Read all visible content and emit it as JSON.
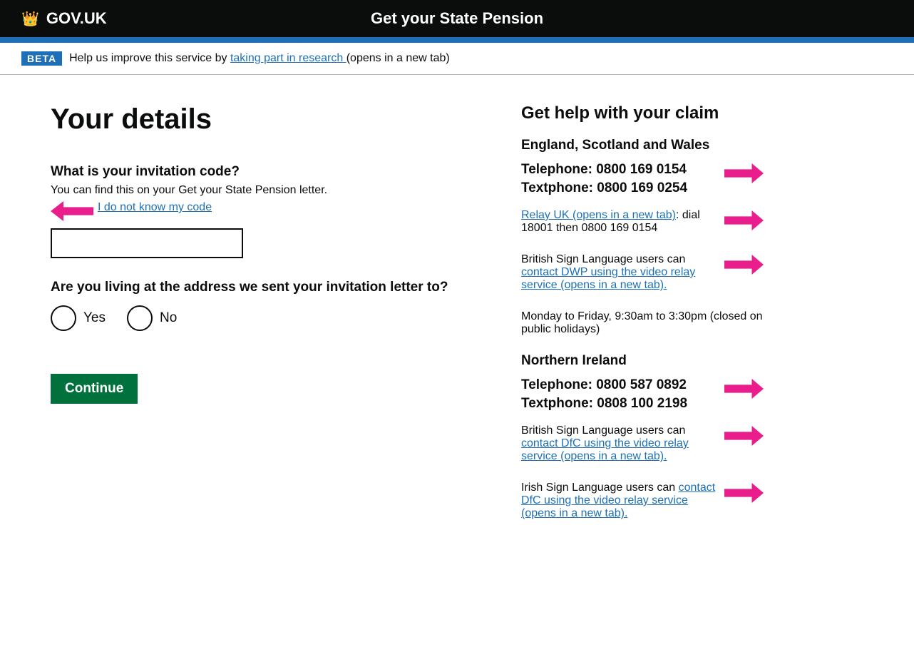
{
  "header": {
    "logo_text": "GOV.UK",
    "title": "Get your State Pension"
  },
  "beta": {
    "tag": "BETA",
    "text": "Help us improve this service by",
    "link_text": "taking part in research",
    "link_suffix": "(opens in a new tab)"
  },
  "main": {
    "page_title": "Your details",
    "invitation_code": {
      "label": "What is your invitation code?",
      "hint": "You can find this on your Get your State Pension letter.",
      "link_text": "I do not know my code",
      "input_value": "",
      "input_placeholder": ""
    },
    "address_question": {
      "label": "Are you living at the address we sent your invitation letter to?",
      "option_yes": "Yes",
      "option_no": "No"
    },
    "continue_button": "Continue"
  },
  "sidebar": {
    "title": "Get help with your claim",
    "england_section": {
      "region_title": "England, Scotland and Wales",
      "telephone": "Telephone: 0800 169 0154",
      "textphone": "Textphone: 0800 169 0254",
      "relay_link_text": "Relay UK (opens in a new tab)",
      "relay_text": ": dial 18001 then 0800 169 0154",
      "bsl_text_prefix": "British Sign Language users can",
      "bsl_link_text": "contact DWP using the video relay service (opens in a new tab).",
      "hours": "Monday to Friday, 9:30am to 3:30pm (closed on public holidays)"
    },
    "northern_ireland_section": {
      "region_title": "Northern Ireland",
      "telephone": "Telephone: 0800 587 0892",
      "textphone": "Textphone: 0808 100 2198",
      "bsl_text_prefix": "British Sign Language users can",
      "bsl_link_text": "contact DfC using the video relay service (opens in a new tab).",
      "isl_text_prefix": "Irish Sign Language users can",
      "isl_link_text": "contact DfC using the video relay service (opens in a new tab)."
    }
  }
}
